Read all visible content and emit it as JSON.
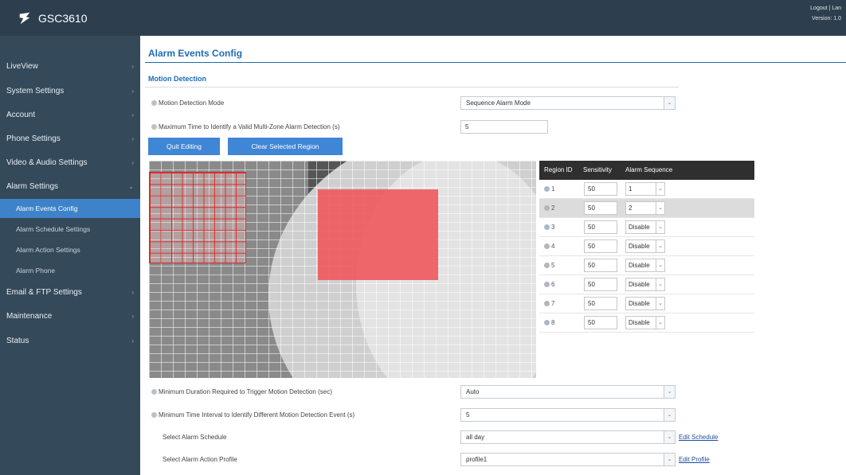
{
  "header": {
    "product": "GSC3610",
    "top_links": [
      "Logout",
      "|",
      "Lan"
    ],
    "top_sub": "Version: 1.0"
  },
  "sidebar": {
    "items": [
      {
        "label": "LiveView",
        "chev": "›"
      },
      {
        "label": "System Settings",
        "chev": "›"
      },
      {
        "label": "Account",
        "chev": "›"
      },
      {
        "label": "Phone Settings",
        "chev": "›"
      },
      {
        "label": "Video & Audio Settings",
        "chev": "›"
      },
      {
        "label": "Alarm Settings",
        "chev": "⌄"
      },
      {
        "label": "Alarm Events Config",
        "chev": ""
      },
      {
        "label": "Alarm Schedule Settings",
        "chev": ""
      },
      {
        "label": "Alarm Action Settings",
        "chev": ""
      },
      {
        "label": "Alarm Phone",
        "chev": ""
      },
      {
        "label": "Email & FTP Settings",
        "chev": "›"
      },
      {
        "label": "Maintenance",
        "chev": "›"
      },
      {
        "label": "Status",
        "chev": "›"
      }
    ]
  },
  "main": {
    "title": "Alarm Events Config",
    "section": "Motion Detection",
    "fields": {
      "mode_label": "Motion Detection Mode",
      "mode_value": "Sequence Alarm Mode",
      "max_time_label": "Maximum Time to Identify a Valid Multi-Zone Alarm Detection (s)",
      "max_time_value": "5",
      "min_duration_label": "Minimum Duration Required to Trigger Motion Detection (sec)",
      "min_duration_value": "Auto",
      "min_interval_label": "Minimum Time Interval to Identify Different Motion Detection Event (s)",
      "min_interval_value": "5",
      "schedule_label": "Select Alarm Schedule",
      "schedule_value": "all day",
      "schedule_link": "Edit Schedule",
      "profile_label": "Select Alarm Action Profile",
      "profile_value": "profile1",
      "profile_link": "Edit Profile"
    },
    "buttons": {
      "quit": "Quit Editing",
      "clear": "Clear Selected Region"
    },
    "region_table": {
      "headers": [
        "Region ID",
        "Sensitivity",
        "Alarm Sequence"
      ],
      "rows": [
        {
          "id": "1",
          "sensitivity": "50",
          "sequence": "1"
        },
        {
          "id": "2",
          "sensitivity": "50",
          "sequence": "2"
        },
        {
          "id": "3",
          "sensitivity": "50",
          "sequence": "Disable"
        },
        {
          "id": "4",
          "sensitivity": "50",
          "sequence": "Disable"
        },
        {
          "id": "5",
          "sensitivity": "50",
          "sequence": "Disable"
        },
        {
          "id": "6",
          "sensitivity": "50",
          "sequence": "Disable"
        },
        {
          "id": "7",
          "sensitivity": "50",
          "sequence": "Disable"
        },
        {
          "id": "8",
          "sensitivity": "50",
          "sequence": "Disable"
        }
      ]
    },
    "dropdown_arrow": "⌄"
  }
}
